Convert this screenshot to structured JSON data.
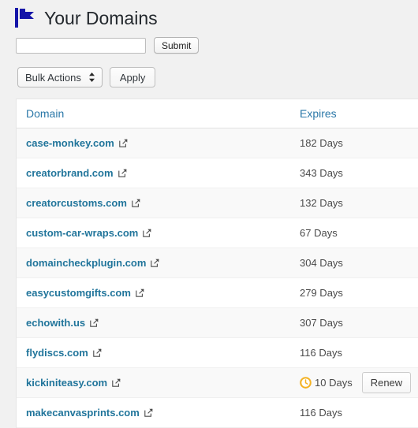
{
  "header": {
    "icon": "flag-icon",
    "title": "Your Domains"
  },
  "search": {
    "value": "",
    "placeholder": "",
    "submit_label": "Submit"
  },
  "bulk": {
    "selected": "Bulk Actions",
    "options": [
      "Bulk Actions"
    ],
    "stepper_icon": "updown-stepper-icon",
    "apply_label": "Apply"
  },
  "table": {
    "columns": [
      "Domain",
      "Expires"
    ],
    "external_link_icon": "external-link-icon",
    "warning_icon": "clock-icon",
    "renew_label": "Renew",
    "rows": [
      {
        "domain": "case-monkey.com",
        "expires": "182 Days",
        "warning": false,
        "renew": false
      },
      {
        "domain": "creatorbrand.com",
        "expires": "343 Days",
        "warning": false,
        "renew": false
      },
      {
        "domain": "creatorcustoms.com",
        "expires": "132 Days",
        "warning": false,
        "renew": false
      },
      {
        "domain": "custom-car-wraps.com",
        "expires": "67 Days",
        "warning": false,
        "renew": false
      },
      {
        "domain": "domaincheckplugin.com",
        "expires": "304 Days",
        "warning": false,
        "renew": false
      },
      {
        "domain": "easycustomgifts.com",
        "expires": "279 Days",
        "warning": false,
        "renew": false
      },
      {
        "domain": "echowith.us",
        "expires": "307 Days",
        "warning": false,
        "renew": false
      },
      {
        "domain": "flydiscs.com",
        "expires": "116 Days",
        "warning": false,
        "renew": false
      },
      {
        "domain": "kickiniteasy.com",
        "expires": "10 Days",
        "warning": true,
        "renew": true
      },
      {
        "domain": "makecanvasprints.com",
        "expires": "116 Days",
        "warning": false,
        "renew": false
      }
    ]
  },
  "colors": {
    "link": "#21759b",
    "header_link": "#2b78a8",
    "flag": "#1515a8",
    "warning": "#f4b223",
    "page_bg": "#f1f1f1",
    "row_alt_bg": "#f9f9f9",
    "title": "#23282d"
  }
}
